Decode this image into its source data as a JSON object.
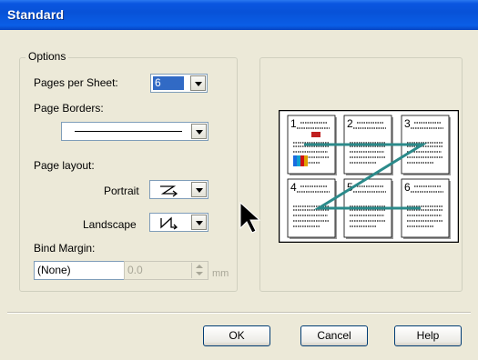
{
  "window": {
    "title": "Standard"
  },
  "options": {
    "group_label": "Options",
    "pages_per_sheet": {
      "label": "Pages per Sheet:",
      "value": "6"
    },
    "page_borders": {
      "label": "Page Borders:"
    },
    "page_layout": {
      "label": "Page layout:",
      "portrait_label": "Portrait",
      "landscape_label": "Landscape"
    },
    "bind_margin": {
      "label": "Bind Margin:",
      "value": "(None)"
    },
    "margin": {
      "value": "0.0",
      "unit": "mm"
    }
  },
  "preview": {
    "page_numbers": [
      "1",
      "2",
      "3",
      "4",
      "5",
      "6"
    ]
  },
  "buttons": {
    "ok": "OK",
    "cancel": "Cancel",
    "help": "Help"
  },
  "colors": {
    "title_bar": "#0a56e0",
    "dialog_bg": "#ece9d8",
    "selection": "#316ac5",
    "flow_line": "#2b8a8a"
  }
}
